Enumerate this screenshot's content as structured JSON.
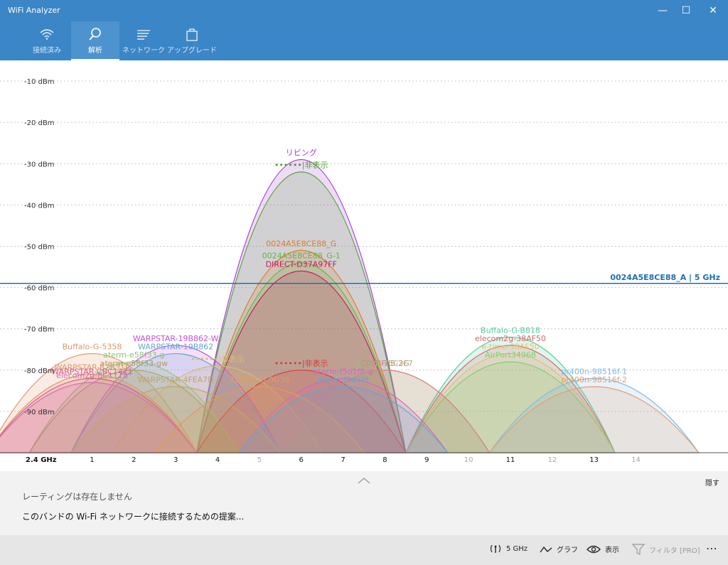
{
  "app": {
    "title": "WiFi Analyzer"
  },
  "window_controls": [
    "—",
    "☐",
    "✕"
  ],
  "nav": {
    "tabs": [
      {
        "label": "接続済み",
        "icon": "wifi-icon",
        "active": false
      },
      {
        "label": "解析",
        "icon": "analyze-icon",
        "active": true
      },
      {
        "label": "ネットワーク",
        "icon": "network-list-icon",
        "active": false
      },
      {
        "label": "アップグレード",
        "icon": "shopping-bag-icon",
        "active": false
      }
    ]
  },
  "chart_data": {
    "type": "area",
    "title": "",
    "band_label": "2.4 GHz",
    "ylim": [
      -100,
      -5
    ],
    "xlim": [
      -1.2,
      16.2
    ],
    "y_ticks": [
      {
        "value": -10,
        "label": "-10 dBm"
      },
      {
        "value": -20,
        "label": "-20 dBm"
      },
      {
        "value": -30,
        "label": "-30 dBm"
      },
      {
        "value": -40,
        "label": "-40 dBm"
      },
      {
        "value": -50,
        "label": "-50 dBm"
      },
      {
        "value": -60,
        "label": "-60 dBm"
      },
      {
        "value": -70,
        "label": "-70 dBm"
      },
      {
        "value": -80,
        "label": "-80 dBm"
      },
      {
        "value": -90,
        "label": "-90 dBm"
      }
    ],
    "x_ticks": [
      {
        "value": 1,
        "label": "1",
        "active": true
      },
      {
        "value": 2,
        "label": "2",
        "active": true
      },
      {
        "value": 3,
        "label": "3",
        "active": true
      },
      {
        "value": 4,
        "label": "4",
        "active": true
      },
      {
        "value": 5,
        "label": "5",
        "active": false
      },
      {
        "value": 6,
        "label": "6",
        "active": true
      },
      {
        "value": 7,
        "label": "7",
        "active": true
      },
      {
        "value": 8,
        "label": "8",
        "active": true
      },
      {
        "value": 9,
        "label": "9",
        "active": true
      },
      {
        "value": 10,
        "label": "10",
        "active": false
      },
      {
        "value": 11,
        "label": "11",
        "active": true
      },
      {
        "value": 12,
        "label": "12",
        "active": false
      },
      {
        "value": 13,
        "label": "13",
        "active": true
      },
      {
        "value": 14,
        "label": "14",
        "active": false
      }
    ],
    "reference_line": {
      "value": -59,
      "label": "0024A5E8CE88_A | 5 GHz",
      "color": "#1f6fb5"
    },
    "series": [
      {
        "name": "リビング",
        "channel": 6,
        "peak": -29,
        "color": "#a23ad6"
      },
      {
        "name": "••••••|非表示",
        "channel": 6,
        "peak": -32,
        "color": "#4ca52a"
      },
      {
        "name": "0024A5E8CE88_G",
        "channel": 6,
        "peak": -51,
        "color": "#d97b2b"
      },
      {
        "name": "0024A5E8CE88_G-1",
        "channel": 6,
        "peak": -54,
        "color": "#5fb840"
      },
      {
        "name": "DIRECT-D37A97FF",
        "channel": 6,
        "peak": -56,
        "color": "#c2185b"
      },
      {
        "name": "••••••|非表示",
        "channel": 6,
        "peak": -80,
        "color": "#d63a3a"
      },
      {
        "name": "Buffalo-G-5358",
        "channel": 1,
        "peak": -76,
        "color": "#e0986a"
      },
      {
        "name": "WARPSTAR-19B862-W",
        "channel": 3,
        "peak": -74,
        "color": "#c64fd6"
      },
      {
        "name": "WARPSTAR-19B862",
        "channel": 3,
        "peak": -76,
        "color": "#5fa8d3"
      },
      {
        "name": "aterm-e58f33-g",
        "channel": 2,
        "peak": -78,
        "color": "#8cc47a"
      },
      {
        "name": "aterm-e58f33-gw",
        "channel": 2,
        "peak": -80,
        "color": "#a8a060"
      },
      {
        "name": "WARPSTAR-B7B31F",
        "channel": 1,
        "peak": -81,
        "color": "#e0986a"
      },
      {
        "name": "WARPSTAR-CBC1421",
        "channel": 1,
        "peak": -82,
        "color": "#e05a8a"
      },
      {
        "name": "elecom2g-8C1118",
        "channel": 1,
        "peak": -83,
        "color": "#d66fb0"
      },
      {
        "name": "WARPSTAR-4FEA7D",
        "channel": 3,
        "peak": -84,
        "color": "#c2a46a"
      },
      {
        "name": "••••••|非表示",
        "channel": 4,
        "peak": -79,
        "color": "#d8b97a"
      },
      {
        "name": "Buffalo-G-0D38",
        "channel": 5,
        "peak": -84,
        "color": "#e09a60"
      },
      {
        "name": "aterm-15C3F7",
        "channel": 8,
        "peak": -80,
        "color": "#8cc47a"
      },
      {
        "name": "C09BFA5-2G",
        "channel": 8,
        "peak": -80,
        "color": "#d88080"
      },
      {
        "name": "aterm-f5d1f8-g",
        "channel": 7,
        "peak": -82,
        "color": "#d06ab8"
      },
      {
        "name": "aterm-f5d1f8",
        "channel": 7,
        "peak": -84,
        "color": "#5fa8d3"
      },
      {
        "name": "Buffalo-G-B818",
        "channel": 11,
        "peak": -72,
        "color": "#4fcf9a"
      },
      {
        "name": "elecom2g-38AF50",
        "channel": 11,
        "peak": -74,
        "color": "#d06a6a"
      },
      {
        "name": "e-time-38AF50",
        "channel": 11,
        "peak": -76,
        "color": "#e0c070"
      },
      {
        "name": "AirPort34968",
        "channel": 11,
        "peak": -78,
        "color": "#7fcf6a"
      },
      {
        "name": "pr400n-98516f-1",
        "channel": 13,
        "peak": -82,
        "color": "#80b8e8"
      },
      {
        "name": "pr400n-98516f-2",
        "channel": 13,
        "peak": -84,
        "color": "#e0a070"
      }
    ]
  },
  "panel": {
    "hide_label": "隠す",
    "rating_text": "レーティングは存在しません",
    "suggestion_text": "このバンドの Wi-Fi ネットワークに接続するための提案..."
  },
  "commands": {
    "band": "5 GHz",
    "graph": "グラフ",
    "view": "表示",
    "filter": "フィルタ [PRO]",
    "more": "⋯"
  }
}
